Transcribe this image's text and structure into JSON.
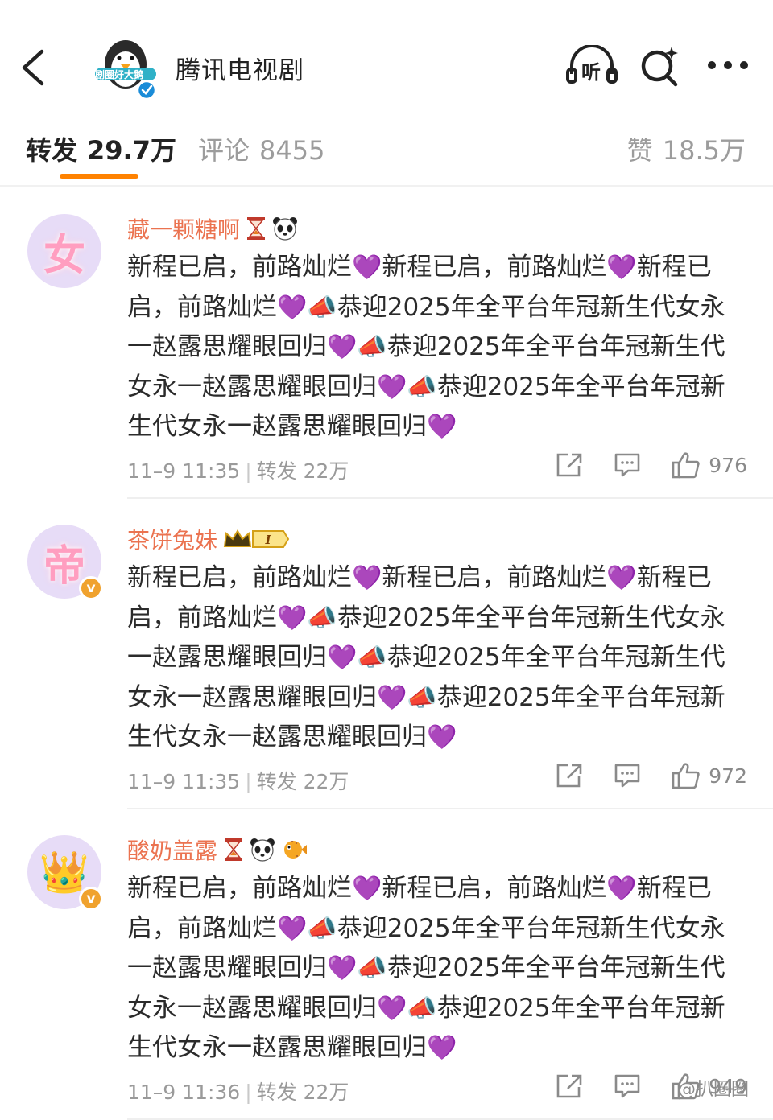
{
  "header": {
    "account_name": "腾讯电视剧",
    "avatar_caption": "剧圈好大鹅",
    "listen_label": "听"
  },
  "tabs": {
    "repost_label": "转发",
    "repost_count": "29.7万",
    "comment_label": "评论",
    "comment_count": "8455",
    "like_label": "赞",
    "like_count": "18.5万"
  },
  "colors": {
    "accent": "#ff8200",
    "username": "#eb7350",
    "heart": "#9b3ad8",
    "vip": "#f0a22e"
  },
  "posts": [
    {
      "username": "藏一颗糖啊",
      "avatar_glyph": "女",
      "verified": false,
      "emblems": [
        "hourglass-emoji",
        "panda-emoji"
      ],
      "seg1": "新程已启，前路灿烂",
      "seg2": "新程已启，前路灿烂",
      "seg3": "新程已启，前路灿烂",
      "seg4": "恭迎2025年全平台年冠新生代女永一赵露思耀眼回归",
      "seg5": "恭迎2025年全平台年冠新生代女永一赵露思耀眼回归",
      "seg6": "恭迎2025年全平台年冠新生代女永一赵露思耀眼回归",
      "date": "11–9 11:35",
      "sep": "|",
      "repost_text": "转发 22万",
      "likes": "976"
    },
    {
      "username": "茶饼兔妹",
      "avatar_glyph": "帝",
      "verified": true,
      "emblems": [
        "crown-level-badge"
      ],
      "level": "I",
      "seg1": "新程已启，前路灿烂",
      "seg2": "新程已启，前路灿烂",
      "seg3": "新程已启，前路灿烂",
      "seg4": "恭迎2025年全平台年冠新生代女永一赵露思耀眼回归",
      "seg5": "恭迎2025年全平台年冠新生代女永一赵露思耀眼回归",
      "seg6": "恭迎2025年全平台年冠新生代女永一赵露思耀眼回归",
      "date": "11–9 11:35",
      "sep": "|",
      "repost_text": "转发 22万",
      "likes": "972"
    },
    {
      "username": "酸奶盖露",
      "avatar_glyph": "👑",
      "verified": true,
      "emblems": [
        "hourglass-emoji",
        "panda-emoji",
        "pufferfish-emoji"
      ],
      "seg1": "新程已启，前路灿烂",
      "seg2": "新程已启，前路灿烂",
      "seg3": "新程已启，前路灿烂",
      "seg4": "恭迎2025年全平台年冠新生代女永一赵露思耀眼回归",
      "seg5": "恭迎2025年全平台年冠新生代女永一赵露思耀眼回归",
      "seg6": "恭迎2025年全平台年冠新生代女永一赵露思耀眼回归",
      "date": "11–9 11:36",
      "sep": "|",
      "repost_text": "转发 22万",
      "likes": "949"
    }
  ],
  "symbols": {
    "heart": "💜",
    "horn": "📣",
    "verified": "v"
  },
  "watermark": "@扒圈圈"
}
